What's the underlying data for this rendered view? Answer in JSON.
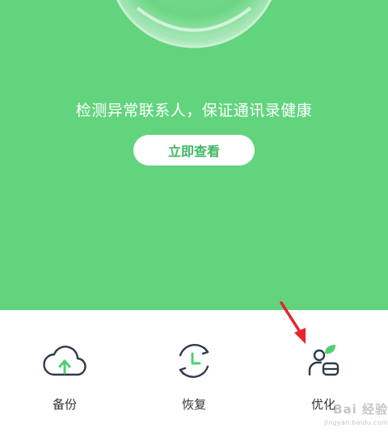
{
  "hero": {
    "headline": "检测异常联系人，保证通讯录健康",
    "view_button": "立即查看"
  },
  "actions": [
    {
      "label": "备份",
      "icon": "cloud-upload-icon"
    },
    {
      "label": "恢复",
      "icon": "restore-clock-icon"
    },
    {
      "label": "优化",
      "icon": "optimize-contact-icon"
    }
  ],
  "watermark": {
    "main": "Bai 经验",
    "sub": "jingyan.baidu.com"
  },
  "colors": {
    "brand_green": "#62d47e",
    "button_text": "#3fb864",
    "icon_outline": "#2f3a4a",
    "annotation_arrow": "#e8242a"
  }
}
